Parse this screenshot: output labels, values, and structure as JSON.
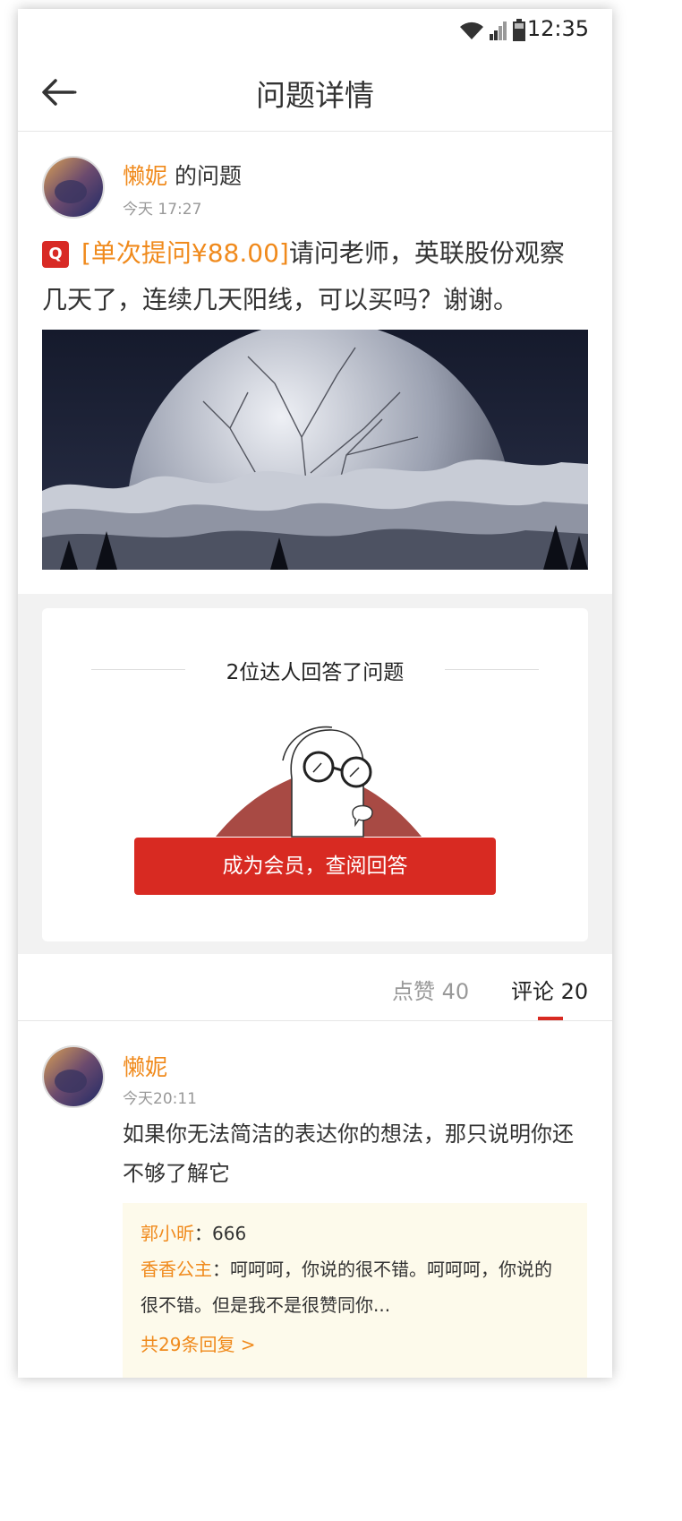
{
  "status_bar": {
    "time": "12:35"
  },
  "nav": {
    "title": "问题详情"
  },
  "question": {
    "author": "懒妮",
    "author_suffix": " 的问题",
    "time": "今天 17:27",
    "badge": "Q",
    "price_tag": "[单次提问¥88.00]",
    "text": "请问老师，英联股份观察几天了，连续几天阳线，可以买吗？谢谢。"
  },
  "answers": {
    "title": "2位达人回答了问题",
    "button_label": "成为会员，查阅回答"
  },
  "tabs": {
    "like_label": "点赞 40",
    "comment_label": "评论 20"
  },
  "comment": {
    "author": "懒妮",
    "time": "今天20:11",
    "text": "如果你无法简洁的表达你的想法，那只说明你还不够了解它",
    "replies": [
      {
        "name": "郭小昕",
        "text": "：666"
      },
      {
        "name": "香香公主",
        "text": "：呵呵呵，你说的很不错。呵呵呵，你说的很不错。但是我不是很赞同你..."
      }
    ],
    "more_label": "共29条回复  >"
  },
  "colors": {
    "accent": "#d82a22",
    "orange": "#f08a1c"
  }
}
